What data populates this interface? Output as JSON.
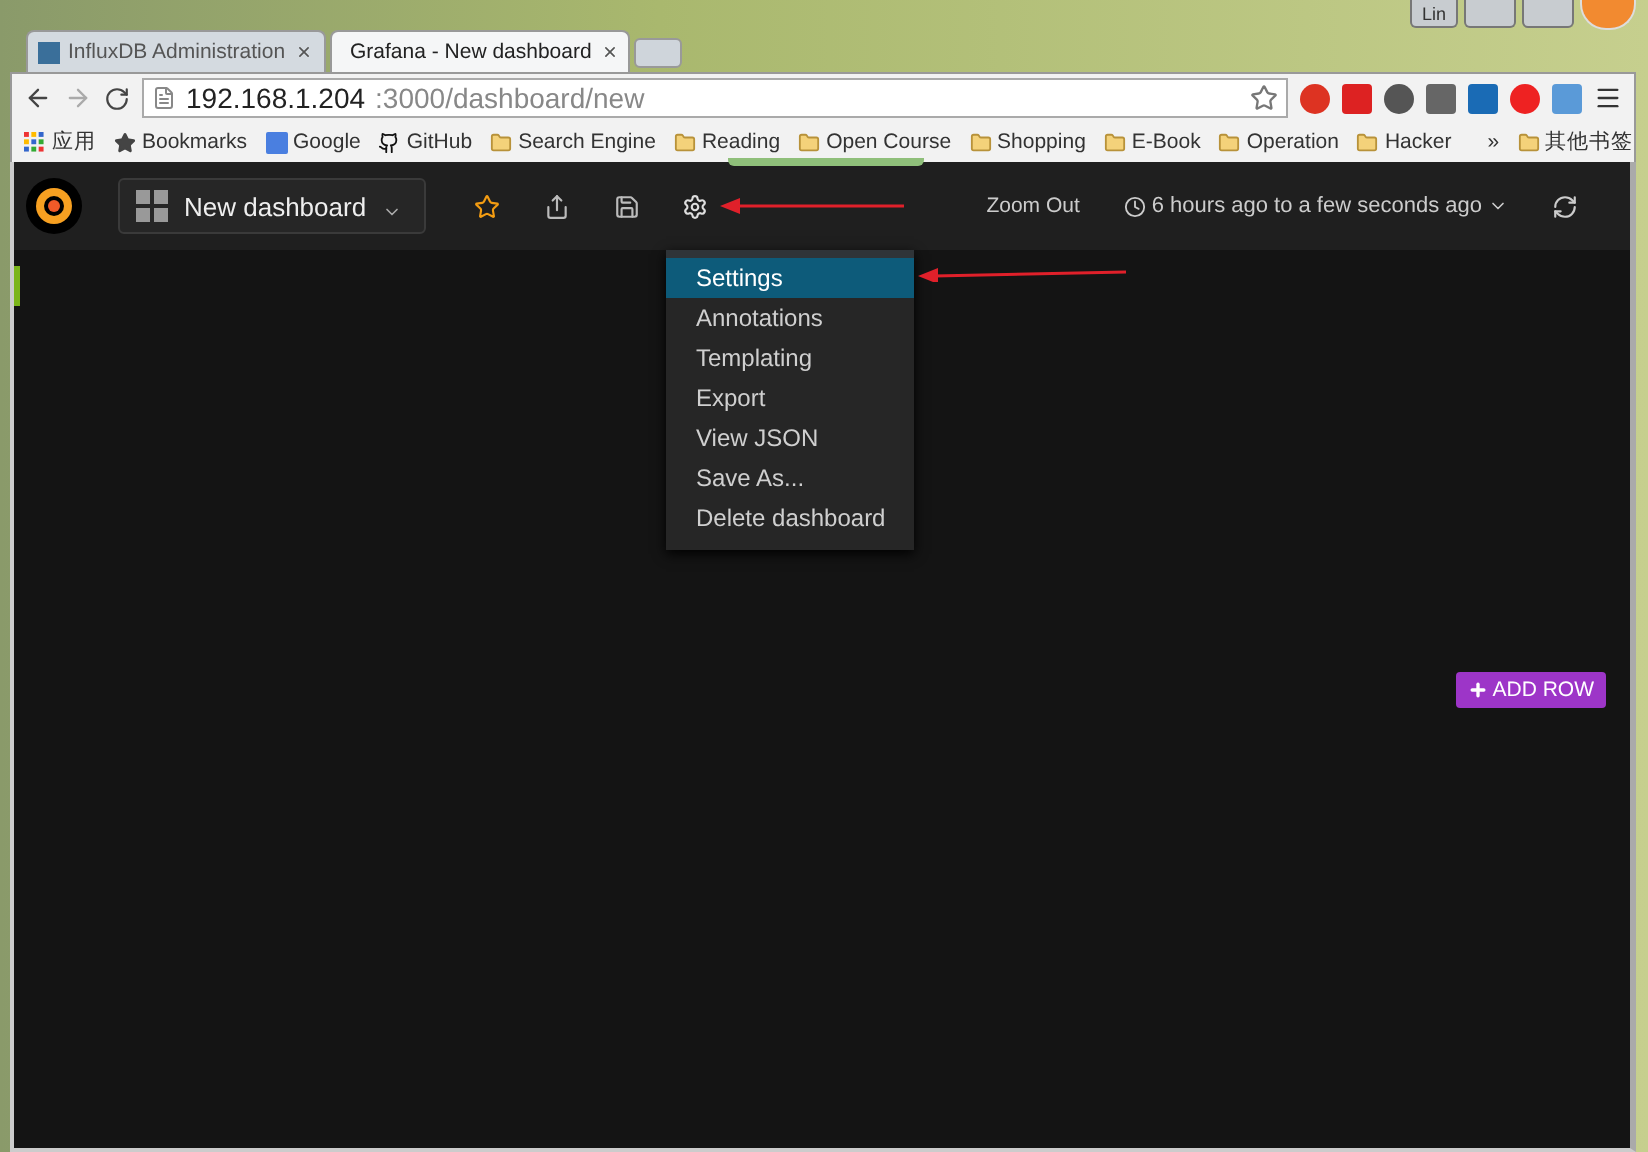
{
  "window": {
    "user_badge": "Lin"
  },
  "tabs": [
    {
      "title": "InfluxDB Administration",
      "selected": false,
      "kind": "influx"
    },
    {
      "title": "Grafana - New dashboard",
      "selected": true,
      "kind": "grafana"
    }
  ],
  "address": {
    "host": "192.168.1.204",
    "path": ":3000/dashboard/new"
  },
  "bookmarks": [
    {
      "label": "应用",
      "kind": "apps"
    },
    {
      "label": "Bookmarks",
      "kind": "star"
    },
    {
      "label": "Google",
      "kind": "google"
    },
    {
      "label": "GitHub",
      "kind": "github"
    },
    {
      "label": "Search Engine",
      "kind": "folder"
    },
    {
      "label": "Reading",
      "kind": "folder"
    },
    {
      "label": "Open Course",
      "kind": "folder"
    },
    {
      "label": "Shopping",
      "kind": "folder"
    },
    {
      "label": "E-Book",
      "kind": "folder"
    },
    {
      "label": "Operation",
      "kind": "folder"
    },
    {
      "label": "Hacker",
      "kind": "folder"
    }
  ],
  "bookmarks_overflow": "»",
  "other_bookmarks": "其他书签",
  "navbar": {
    "dashboard_title": "New dashboard",
    "starred": false,
    "zoom_out": "Zoom Out",
    "time_range": "6 hours ago to a few seconds ago"
  },
  "menu": [
    {
      "label": "Settings",
      "selected": true
    },
    {
      "label": "Annotations",
      "selected": false
    },
    {
      "label": "Templating",
      "selected": false
    },
    {
      "label": "Export",
      "selected": false
    },
    {
      "label": "View JSON",
      "selected": false
    },
    {
      "label": "Save As...",
      "selected": false
    },
    {
      "label": "Delete dashboard",
      "selected": false
    }
  ],
  "add_row": "ADD ROW"
}
